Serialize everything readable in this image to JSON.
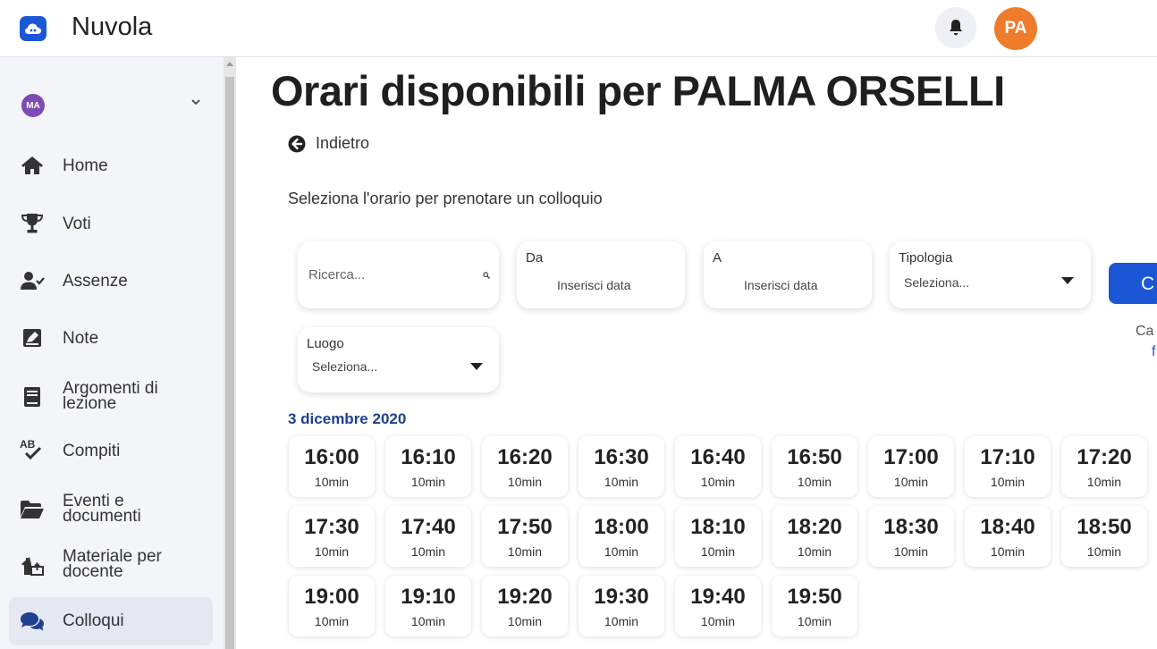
{
  "app": {
    "title": "Nuvola",
    "user_initials": "PA"
  },
  "sidebar": {
    "user_initials": "MA",
    "items": [
      {
        "label": "Home",
        "icon": "home-icon"
      },
      {
        "label": "Voti",
        "icon": "trophy-icon"
      },
      {
        "label": "Assenze",
        "icon": "user-check-icon"
      },
      {
        "label": "Note",
        "icon": "note-icon"
      },
      {
        "label": "Argomenti di lezione",
        "icon": "book-icon"
      },
      {
        "label": "Compiti",
        "icon": "spellcheck-icon"
      },
      {
        "label": "Eventi e documenti",
        "icon": "folder-icon"
      },
      {
        "label": "Materiale per docente",
        "icon": "house-upload-icon"
      },
      {
        "label": "Colloqui",
        "icon": "chat-icon"
      }
    ]
  },
  "main": {
    "title": "Orari disponibili per PALMA ORSELLI",
    "back_label": "Indietro",
    "subtitle": "Seleziona l'orario per prenotare un colloquio"
  },
  "filters": {
    "search_placeholder": "Ricerca...",
    "from_label": "Da",
    "from_value": "Inserisci data",
    "to_label": "A",
    "to_value": "Inserisci data",
    "type_label": "Tipologia",
    "type_value": "Seleziona...",
    "place_label": "Luogo",
    "place_value": "Seleziona...",
    "search_button": "C",
    "clipped_text_1": "Ca",
    "clipped_text_2": "f"
  },
  "schedule": {
    "date": "3 dicembre 2020",
    "slots": [
      {
        "time": "16:00",
        "duration": "10min"
      },
      {
        "time": "16:10",
        "duration": "10min"
      },
      {
        "time": "16:20",
        "duration": "10min"
      },
      {
        "time": "16:30",
        "duration": "10min"
      },
      {
        "time": "16:40",
        "duration": "10min"
      },
      {
        "time": "16:50",
        "duration": "10min"
      },
      {
        "time": "17:00",
        "duration": "10min"
      },
      {
        "time": "17:10",
        "duration": "10min"
      },
      {
        "time": "17:20",
        "duration": "10min"
      },
      {
        "time": "17:30",
        "duration": "10min"
      },
      {
        "time": "17:40",
        "duration": "10min"
      },
      {
        "time": "17:50",
        "duration": "10min"
      },
      {
        "time": "18:00",
        "duration": "10min"
      },
      {
        "time": "18:10",
        "duration": "10min"
      },
      {
        "time": "18:20",
        "duration": "10min"
      },
      {
        "time": "18:30",
        "duration": "10min"
      },
      {
        "time": "18:40",
        "duration": "10min"
      },
      {
        "time": "18:50",
        "duration": "10min"
      },
      {
        "time": "19:00",
        "duration": "10min"
      },
      {
        "time": "19:10",
        "duration": "10min"
      },
      {
        "time": "19:20",
        "duration": "10min"
      },
      {
        "time": "19:30",
        "duration": "10min"
      },
      {
        "time": "19:40",
        "duration": "10min"
      },
      {
        "time": "19:50",
        "duration": "10min"
      }
    ]
  },
  "colors": {
    "accent": "#1a56d6",
    "avatar_top": "#ee7c2b",
    "avatar_user": "#7c4bb5",
    "date_heading": "#1f3f8f"
  }
}
